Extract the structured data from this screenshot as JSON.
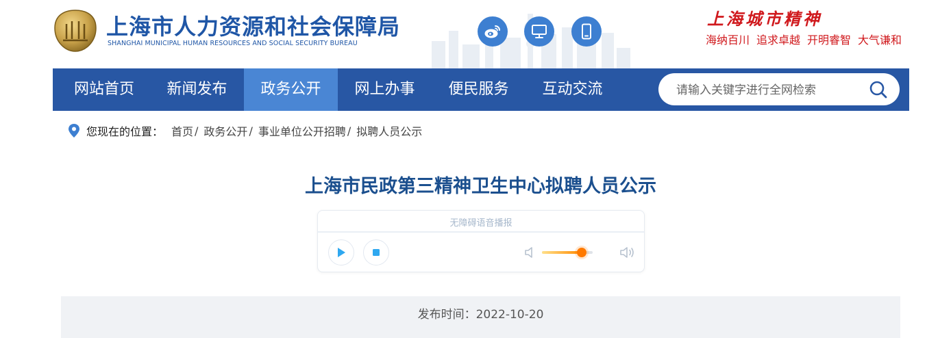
{
  "header": {
    "org_name_cn": "上海市人力资源和社会保障局",
    "org_name_en": "SHANGHAI MUNICIPAL HUMAN RESOURCES AND SOCIAL SECURITY BUREAU",
    "social_icons": [
      "weibo-icon",
      "desktop-icon",
      "mobile-icon"
    ],
    "city_spirit": {
      "title": "上海城市精神",
      "words": [
        "海纳百川",
        "追求卓越",
        "开明睿智",
        "大气谦和"
      ]
    }
  },
  "nav": {
    "items": [
      {
        "label": "网站首页"
      },
      {
        "label": "新闻发布"
      },
      {
        "label": "政务公开"
      },
      {
        "label": "网上办事"
      },
      {
        "label": "便民服务"
      },
      {
        "label": "互动交流"
      }
    ],
    "active_index": 2,
    "search": {
      "placeholder": "请输入关键字进行全网检索",
      "value": ""
    }
  },
  "breadcrumb": {
    "prefix": "您现在的位置：",
    "items": [
      "首页",
      "政务公开",
      "事业单位公开招聘",
      "拟聘人员公示"
    ],
    "separator": "/"
  },
  "article": {
    "title": "上海市民政第三精神卫生中心拟聘人员公示",
    "publish_label": "发布时间：",
    "publish_date": "2022-10-20"
  },
  "player": {
    "label": "无障碍语音播报",
    "volume": 0.78
  },
  "colors": {
    "nav_bg": "#2857a4",
    "nav_active": "#4a86d4",
    "title_blue": "#1b4f8e",
    "spirit_red": "#d0191d",
    "social_blue": "#3d7fd1"
  }
}
